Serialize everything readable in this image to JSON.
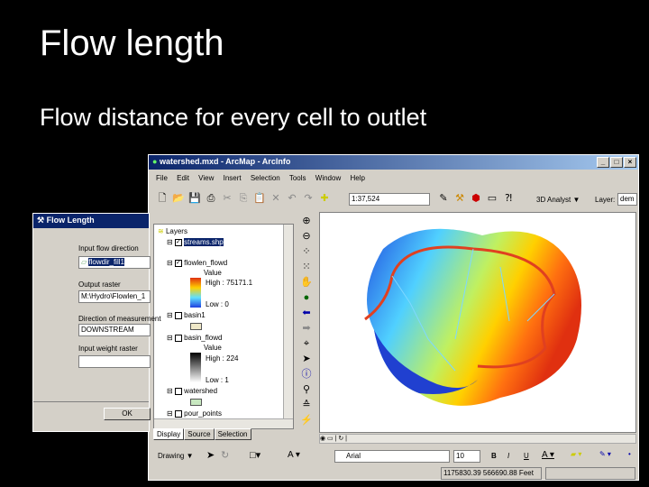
{
  "slide": {
    "title": "Flow length",
    "subtitle": "Flow distance for every cell to outlet"
  },
  "arcmap": {
    "title": "watershed.mxd - ArcMap - ArcInfo",
    "menu": [
      "File",
      "Edit",
      "View",
      "Insert",
      "Selection",
      "Tools",
      "Window",
      "Help"
    ],
    "scale": "1:37,524",
    "analyst": "3D Analyst ▼",
    "layer_label": "Layer:",
    "layer_value": "dem",
    "toc": {
      "root": "Layers",
      "layers": [
        {
          "name": "streams.shp",
          "checked": true
        },
        {
          "name": "flowlen_flowd",
          "checked": true,
          "legend_title": "Value",
          "high": "High : 75171.1",
          "low": "Low : 0"
        },
        {
          "name": "basin1",
          "checked": false
        },
        {
          "name": "basin_flowd",
          "checked": false,
          "legend_title": "Value",
          "high": "High : 224",
          "low": "Low : 1"
        },
        {
          "name": "watershed",
          "checked": false
        },
        {
          "name": "pour_points",
          "checked": false
        }
      ],
      "tabs": [
        "Display",
        "Source",
        "Selection"
      ]
    },
    "drawing": {
      "label": "Drawing ▼",
      "font": "Arial",
      "size": "10",
      "bold": "B",
      "italic": "I",
      "underline": "U"
    },
    "status": {
      "coords": "1175830.39  566690.88 Feet"
    }
  },
  "dialog": {
    "title": "Flow Length",
    "input_label": "Input flow direction",
    "input_value": "flowdir_fill1",
    "output_label": "Output raster",
    "output_value": "M:\\Hydro\\Flowlen_1",
    "direction_label": "Direction of measurement",
    "direction_value": "DOWNSTREAM",
    "weight_label": "Input weight raster",
    "weight_value": "",
    "ok": "OK"
  },
  "colors": {
    "titlebar": "#0a246a",
    "chrome": "#d4d0c8",
    "flowline": "#e04020"
  }
}
